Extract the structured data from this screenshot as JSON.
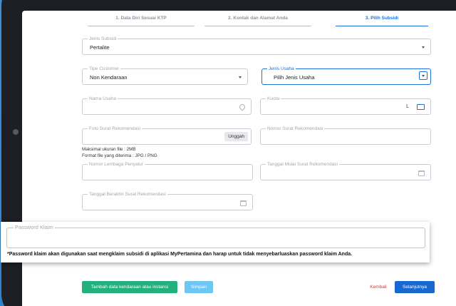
{
  "steps": [
    {
      "label": "1.  Data Diri Sesuai KTP"
    },
    {
      "label": "2.  Kontak dan Alamat Anda"
    },
    {
      "label": "3.  Pilih Subsidi"
    }
  ],
  "form": {
    "jenis_subsidi": {
      "label": "Jenis Subsidi",
      "value": "Pertalite"
    },
    "tipe_customer": {
      "label": "Tipe Customer",
      "value": "Non Kendaraan"
    },
    "jenis_usaha": {
      "label": "Jenis Usaha",
      "value": "Pilih Jenis Usaha"
    },
    "nama_usaha": {
      "label": "Nama Usaha",
      "value": ""
    },
    "kuota": {
      "label": "Kuota",
      "unit": "L"
    },
    "foto_surat": {
      "label": "Foto Surat Rekomendasi",
      "upload_label": "Unggah"
    },
    "nomor_surat": {
      "label": "Nomor Surat Rekomendasi"
    },
    "file_hint_1": "Maksimal ukuran file : 2MB",
    "file_hint_2": "Format file yang diterima : JPG / PNG",
    "nomor_lembaga": {
      "label": "Nomor Lembaga Penyalur"
    },
    "tanggal_mulai": {
      "label": "Tanggal Mulai Surat Rekomendasi"
    },
    "tanggal_berakhir": {
      "label": "Tanggal Berakhir Surat Rekomendasi"
    }
  },
  "password_overlay": {
    "label": "Password Klaim",
    "note": "*Password klaim akan digunakan saat mengklaim subsidi di aplikasi MyPertamina dan harap untuk tidak menyebarluaskan password klaim Anda."
  },
  "buttons": {
    "tambah": "Tambah data kendaraan atau instansi",
    "simpan": "Simpan",
    "kembali": "Kembali",
    "selanjutnya": "Selanjutnya"
  },
  "colors": {
    "accent": "#1f6fd8",
    "tambah_bg": "#22b07d",
    "simpan_bg": "#6ec6f3",
    "kembali": "#d9363e",
    "selanjutnya_bg": "#1769cf"
  },
  "icons": {
    "location": "location-pin-icon",
    "calendar": "calendar-icon",
    "dropdown": "chevron-down-icon",
    "kuota_unit": "fuel-card-icon"
  }
}
